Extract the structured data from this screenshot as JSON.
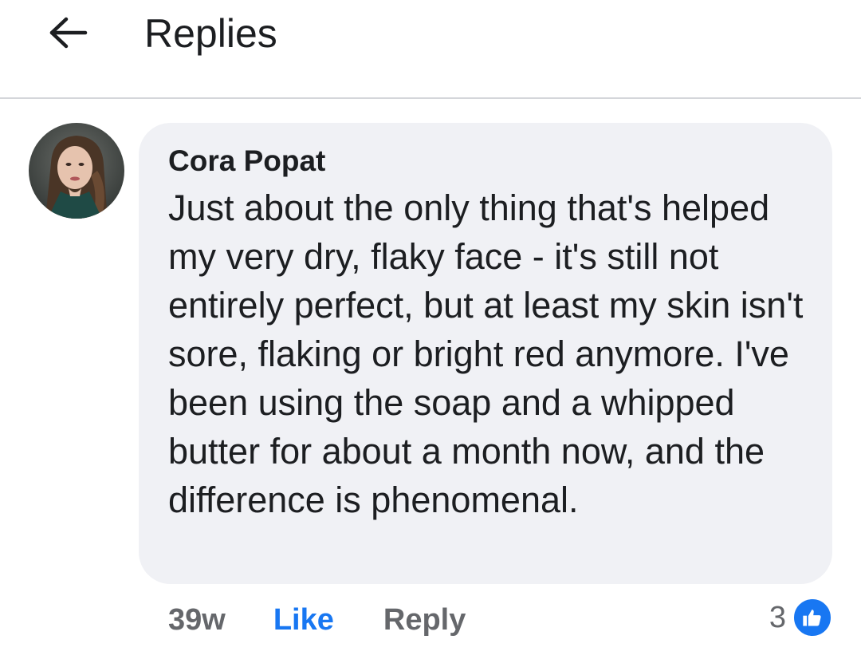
{
  "header": {
    "title": "Replies",
    "back_icon": "arrow-left-icon"
  },
  "comment": {
    "author": "Cora Popat",
    "text": "Just about the only thing that's helped my very dry, flaky face - it's still not entirely perfect, but at least my skin isn't sore, flaking or bright red anymore. I've been using the soap and a whipped butter for about a month now, and the difference is phenomenal.",
    "timestamp": "39w",
    "like_label": "Like",
    "reply_label": "Reply",
    "reaction_count": "3",
    "reaction_icon": "thumbs-up-icon"
  },
  "colors": {
    "accent": "#1877f2",
    "bubble": "#f0f1f5",
    "muted": "#65676b"
  }
}
